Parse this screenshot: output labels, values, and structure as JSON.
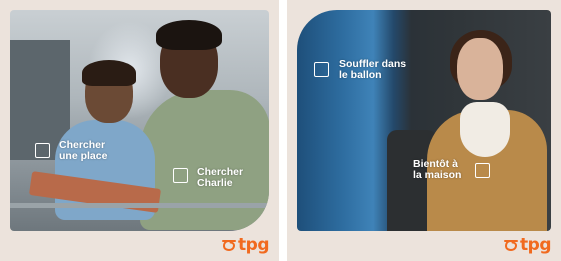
{
  "panels": [
    {
      "labels": [
        {
          "lines": [
            "Chercher",
            "une place"
          ]
        },
        {
          "lines": [
            "Chercher",
            "Charlie"
          ]
        }
      ],
      "logo_text": "tpg"
    },
    {
      "labels": [
        {
          "lines": [
            "Souffler dans",
            "le ballon"
          ]
        },
        {
          "lines": [
            "Bientôt à",
            "la maison"
          ]
        }
      ],
      "logo_text": "tpg"
    }
  ],
  "colors": {
    "brand": "#f16a1f",
    "poster_background": "#ece3dc",
    "label_text": "#ffffff"
  },
  "icons": [
    "checkbox-outline-icon",
    "tpg-logo-mark-icon"
  ]
}
